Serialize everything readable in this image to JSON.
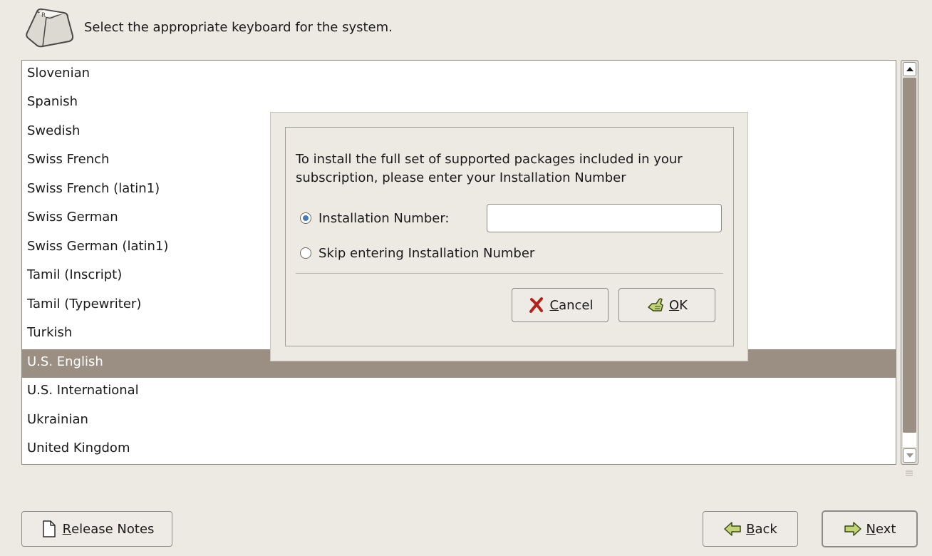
{
  "header": {
    "icon": "keyboard-key-icon",
    "text": "Select the appropriate keyboard for the system."
  },
  "keyboard_list": {
    "items": [
      "Slovenian",
      "Spanish",
      "Swedish",
      "Swiss French",
      "Swiss French (latin1)",
      "Swiss German",
      "Swiss German (latin1)",
      "Tamil (Inscript)",
      "Tamil (Typewriter)",
      "Turkish",
      "U.S. English",
      "U.S. International",
      "Ukrainian",
      "United Kingdom"
    ],
    "selected": "U.S. English"
  },
  "dialog": {
    "message": "To install the full set of supported packages included in your subscription, please enter your Installation Number",
    "options": [
      {
        "label": "Installation Number:",
        "checked": true
      },
      {
        "label": "Skip entering Installation Number",
        "checked": false
      }
    ],
    "installation_number_value": "",
    "cancel": {
      "accel": "C",
      "rest": "ancel",
      "icon": "x-cancel-icon"
    },
    "ok": {
      "accel": "O",
      "rest": "K",
      "icon": "ok-hand-icon"
    }
  },
  "footer": {
    "release_notes": {
      "accel": "R",
      "rest": "elease Notes",
      "icon": "document-icon"
    },
    "back": {
      "accel": "B",
      "rest": "ack",
      "icon": "arrow-left-icon"
    },
    "next": {
      "accel": "N",
      "rest": "ext",
      "icon": "arrow-right-icon"
    }
  },
  "colors": {
    "background": "#ede9e3",
    "selection": "#9a8f82",
    "radio_checked": "#4a78b8"
  }
}
